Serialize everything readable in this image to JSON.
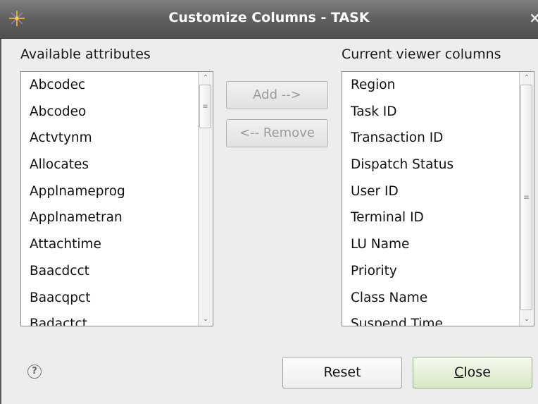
{
  "window": {
    "title": "Customize Columns - TASK",
    "close_glyph": "×"
  },
  "available": {
    "label": "Available attributes",
    "items": [
      "Abcodec",
      "Abcodeo",
      "Actvtynm",
      "Allocates",
      "Applnameprog",
      "Applnametran",
      "Attachtime",
      "Baacdcct",
      "Baacqpct",
      "Badactct"
    ]
  },
  "current": {
    "label": "Current viewer columns",
    "items": [
      "Region",
      "Task ID",
      "Transaction ID",
      "Dispatch Status",
      "User ID",
      "Terminal ID",
      "LU Name",
      "Priority",
      "Class Name",
      "Suspend Time"
    ]
  },
  "buttons": {
    "add": "Add -->",
    "remove": "<-- Remove",
    "reset": "Reset",
    "close_mnemonic": "C",
    "close_rest": "lose"
  },
  "icons": {
    "app": "compass-star-icon",
    "help": "help-icon",
    "help_glyph": "?"
  },
  "colors": {
    "titlebar": "#5f5f5f",
    "close_button": "#d9e6c6"
  }
}
